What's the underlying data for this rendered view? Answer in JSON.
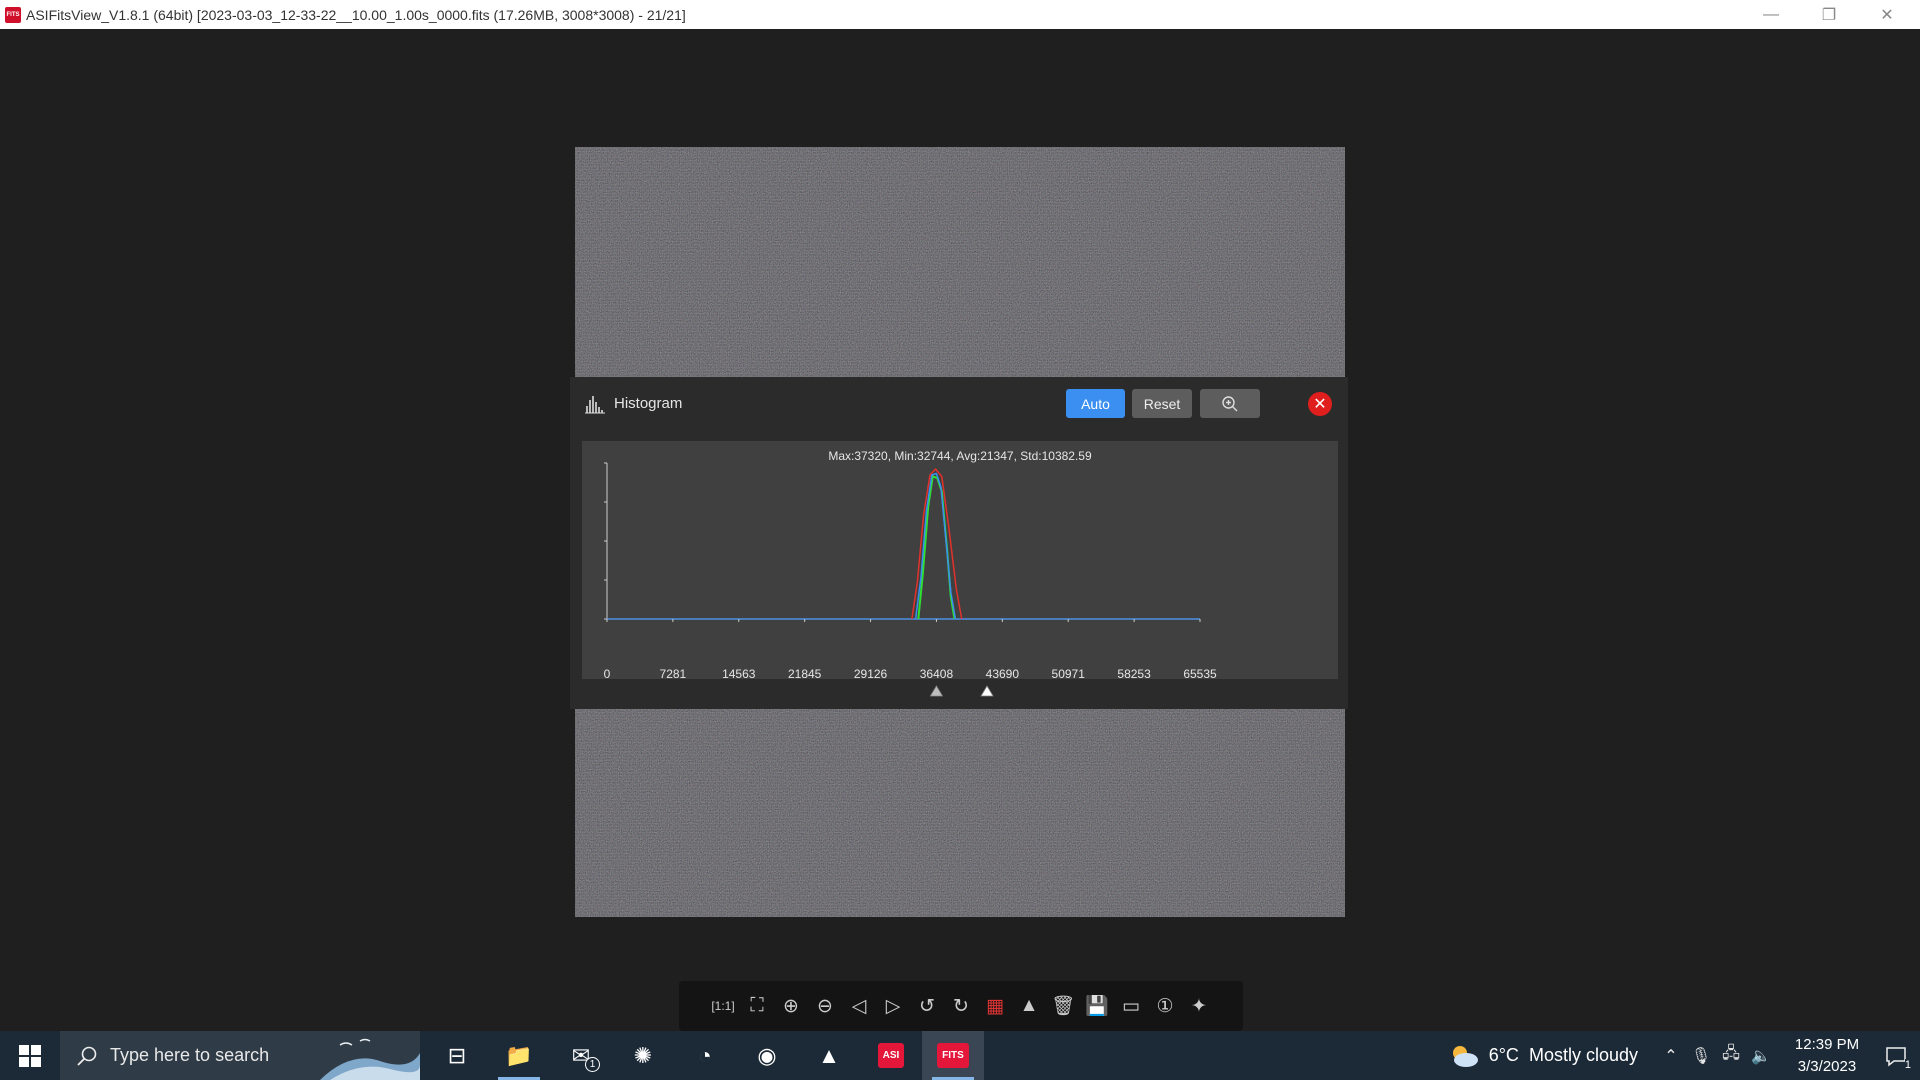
{
  "window": {
    "title": "ASIFitsView_V1.8.1 (64bit) [2023-03-03_12-33-22__10.00_1.00s_0000.fits (17.26MB, 3008*3008) - 21/21]",
    "app_icon_text": "FITS"
  },
  "histogram": {
    "title": "Histogram",
    "auto_label": "Auto",
    "reset_label": "Reset",
    "stats": "Max:37320, Min:32744, Avg:21347, Std:10382.59",
    "x_ticks": [
      "0",
      "7281",
      "14563",
      "21845",
      "29126",
      "36408",
      "43690",
      "50971",
      "58253",
      "65535"
    ],
    "black_point": 36408,
    "white_point": 42000,
    "colors": {
      "red": "#e2312b",
      "green": "#2fe02f",
      "blue": "#3a8ff0",
      "baseline": "#4a90e2"
    }
  },
  "chart_data": {
    "type": "line",
    "xlim": [
      0,
      65535
    ],
    "ylim": [
      0,
      1
    ],
    "x_ticks": [
      0,
      7281,
      14563,
      21845,
      29126,
      36408,
      43690,
      50971,
      58253,
      65535
    ],
    "series": [
      {
        "color": "#e2312b",
        "x": [
          33700,
          34300,
          35000,
          35700,
          36300,
          37000,
          37800,
          38600,
          39200
        ],
        "y": [
          0.0,
          0.25,
          0.7,
          0.96,
          1.0,
          0.95,
          0.6,
          0.2,
          0.0
        ]
      },
      {
        "color": "#2fe02f",
        "x": [
          34400,
          34900,
          35500,
          36000,
          36500,
          37000,
          37600,
          38000,
          38400
        ],
        "y": [
          0.0,
          0.3,
          0.75,
          0.95,
          0.94,
          0.85,
          0.45,
          0.15,
          0.0
        ]
      },
      {
        "color": "#3a8ff0",
        "x": [
          34100,
          34700,
          35300,
          35900,
          36400,
          36900,
          37500,
          38000,
          38500
        ],
        "y": [
          0.0,
          0.28,
          0.72,
          0.96,
          0.97,
          0.88,
          0.5,
          0.18,
          0.0
        ]
      }
    ]
  },
  "toolbar": {
    "items": [
      {
        "name": "actual-size-icon",
        "glyph": "[1:1]"
      },
      {
        "name": "fit-window-icon",
        "glyph": "⛶"
      },
      {
        "name": "zoom-in-icon",
        "glyph": "⊕"
      },
      {
        "name": "zoom-out-icon",
        "glyph": "⊖"
      },
      {
        "name": "previous-icon",
        "glyph": "◁"
      },
      {
        "name": "next-icon",
        "glyph": "▷"
      },
      {
        "name": "rotate-left-icon",
        "glyph": "↺"
      },
      {
        "name": "rotate-right-icon",
        "glyph": "↻"
      },
      {
        "name": "debayer-icon",
        "glyph": "▦"
      },
      {
        "name": "histogram-icon",
        "glyph": "▲"
      },
      {
        "name": "delete-icon",
        "glyph": "🗑"
      },
      {
        "name": "save-icon",
        "glyph": "💾"
      },
      {
        "name": "stretch-icon",
        "glyph": "▭"
      },
      {
        "name": "info-icon",
        "glyph": "①"
      },
      {
        "name": "star-icon",
        "glyph": "✦"
      }
    ]
  },
  "taskbar": {
    "search_placeholder": "Type here to search",
    "apps": [
      {
        "name": "task-view-icon",
        "glyph": "⊟",
        "active": false,
        "open": false
      },
      {
        "name": "file-explorer-icon",
        "glyph": "📁",
        "active": false,
        "open": true
      },
      {
        "name": "mail-icon",
        "glyph": "✉",
        "active": false,
        "open": false,
        "badge": "1"
      },
      {
        "name": "app-k-icon",
        "glyph": "✺",
        "active": false,
        "open": false
      },
      {
        "name": "edge-icon",
        "glyph": "◔",
        "active": false,
        "open": false
      },
      {
        "name": "stellarium-icon",
        "glyph": "◉",
        "active": false,
        "open": false
      },
      {
        "name": "photos-icon",
        "glyph": "▲",
        "active": false,
        "open": false
      },
      {
        "name": "asi-studio-icon",
        "glyph": "ASI",
        "active": false,
        "open": false
      },
      {
        "name": "fitsview-icon",
        "glyph": "FITS",
        "active": true,
        "open": true
      }
    ],
    "weather_temp": "6°C",
    "weather_text": "Mostly cloudy",
    "time": "12:39 PM",
    "date": "3/3/2023",
    "notification_count": "1"
  }
}
